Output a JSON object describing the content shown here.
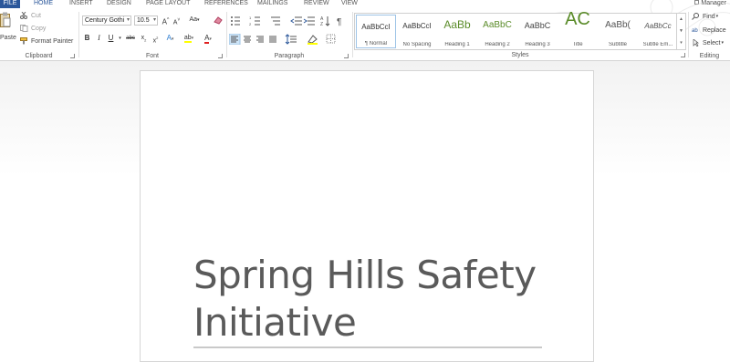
{
  "tabs": {
    "file": "FILE",
    "home": "HOME",
    "insert": "INSERT",
    "design": "DESIGN",
    "page_layout": "PAGE LAYOUT",
    "references": "REFERENCES",
    "mailings": "MAILINGS",
    "review": "REVIEW",
    "view": "VIEW",
    "user": "Manager"
  },
  "clipboard": {
    "paste": "Paste",
    "cut": "Cut",
    "copy": "Copy",
    "format_painter": "Format Painter",
    "label": "Clipboard"
  },
  "font": {
    "family": "Century Gothi",
    "size": "10.5",
    "grow": "A",
    "shrink": "A",
    "change_case": "Aa",
    "bold": "B",
    "italic": "I",
    "underline": "U",
    "strikethrough": "abc",
    "subscript": "x",
    "superscript": "x",
    "text_effects": "A",
    "highlight": "ab",
    "font_color": "A",
    "label": "Font"
  },
  "paragraph": {
    "label": "Paragraph"
  },
  "styles": {
    "label": "Styles",
    "items": [
      {
        "sample": "AaBbCcI",
        "name": "¶ Normal"
      },
      {
        "sample": "AaBbCcI",
        "name": "No Spacing"
      },
      {
        "sample": "AaBb",
        "name": "Heading 1"
      },
      {
        "sample": "AaBbC",
        "name": "Heading 2"
      },
      {
        "sample": "AaBbC",
        "name": "Heading 3"
      },
      {
        "sample": "AC",
        "name": "Title"
      },
      {
        "sample": "AaBb(",
        "name": "Subtitle"
      },
      {
        "sample": "AaBbCc",
        "name": "Subtle Em..."
      }
    ]
  },
  "editing": {
    "find": "Find",
    "replace": "Replace",
    "select": "Select",
    "label": "Editing"
  },
  "document": {
    "title": "Spring Hills Safety Initiative"
  },
  "colors": {
    "accent": "#2b579a",
    "heading_green": "#5b8c2a",
    "title_text": "#5a5a5a"
  }
}
